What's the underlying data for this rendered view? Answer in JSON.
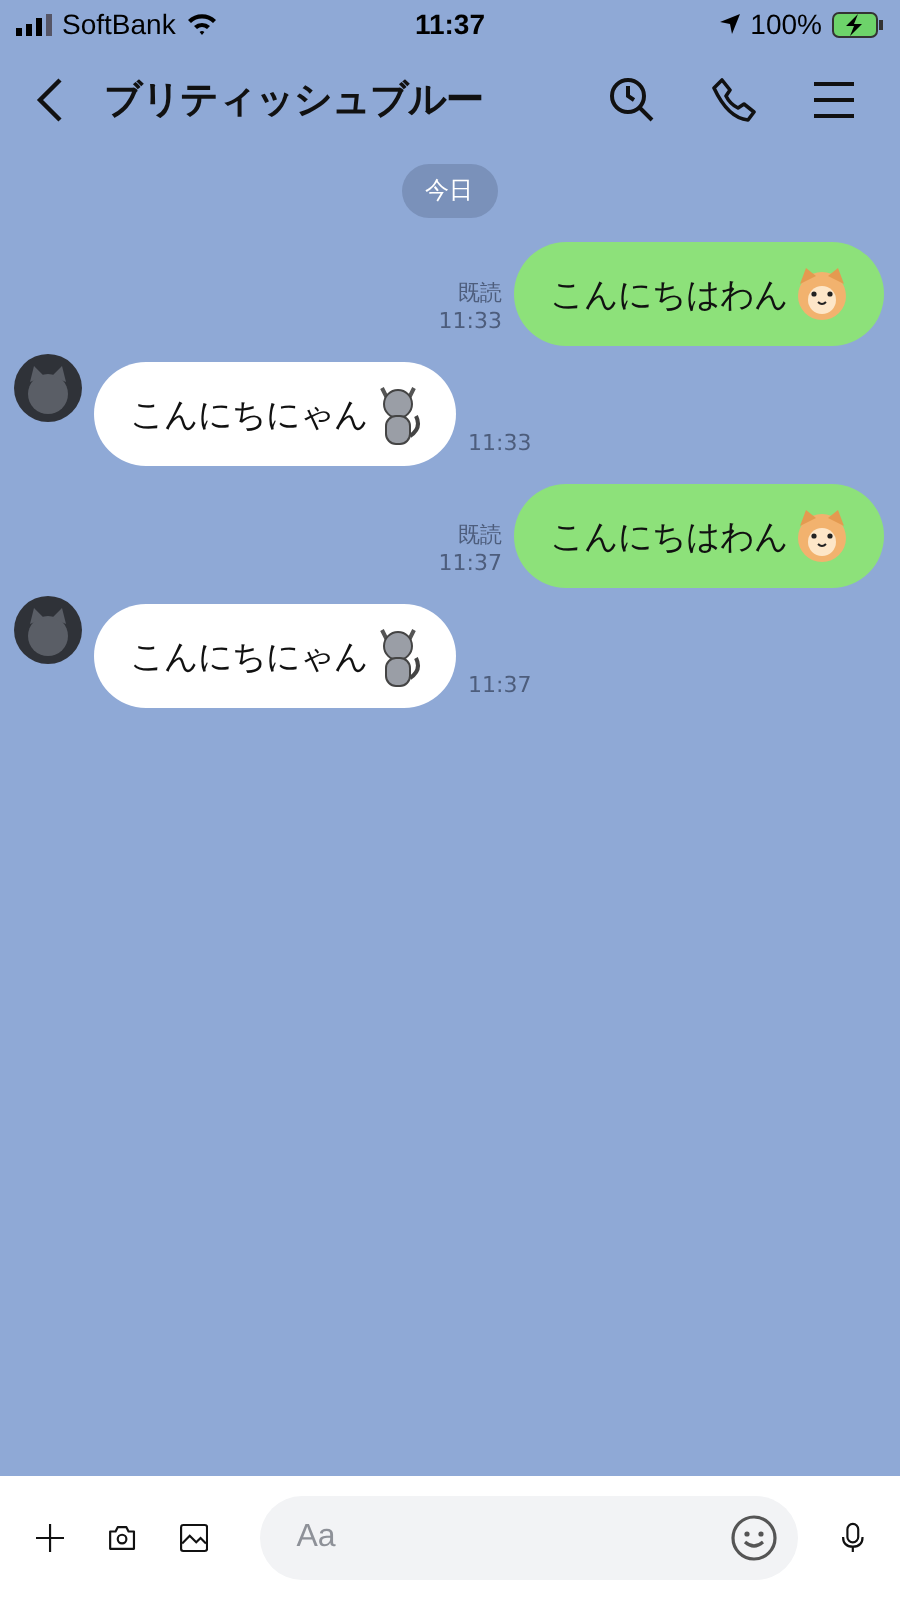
{
  "status_bar": {
    "carrier": "SoftBank",
    "time": "11:37",
    "battery": "100%"
  },
  "header": {
    "title": "ブリティッシュブルー"
  },
  "date_label": "今日",
  "messages": [
    {
      "kind": "sent",
      "text": "こんにちはわん",
      "read": "既読",
      "time": "11:33"
    },
    {
      "kind": "received",
      "text": "こんにちにゃん",
      "time": "11:33"
    },
    {
      "kind": "sent",
      "text": "こんにちはわん",
      "read": "既読",
      "time": "11:37"
    },
    {
      "kind": "received",
      "text": "こんにちにゃん",
      "time": "11:37"
    }
  ],
  "composer": {
    "placeholder": "Aa"
  }
}
